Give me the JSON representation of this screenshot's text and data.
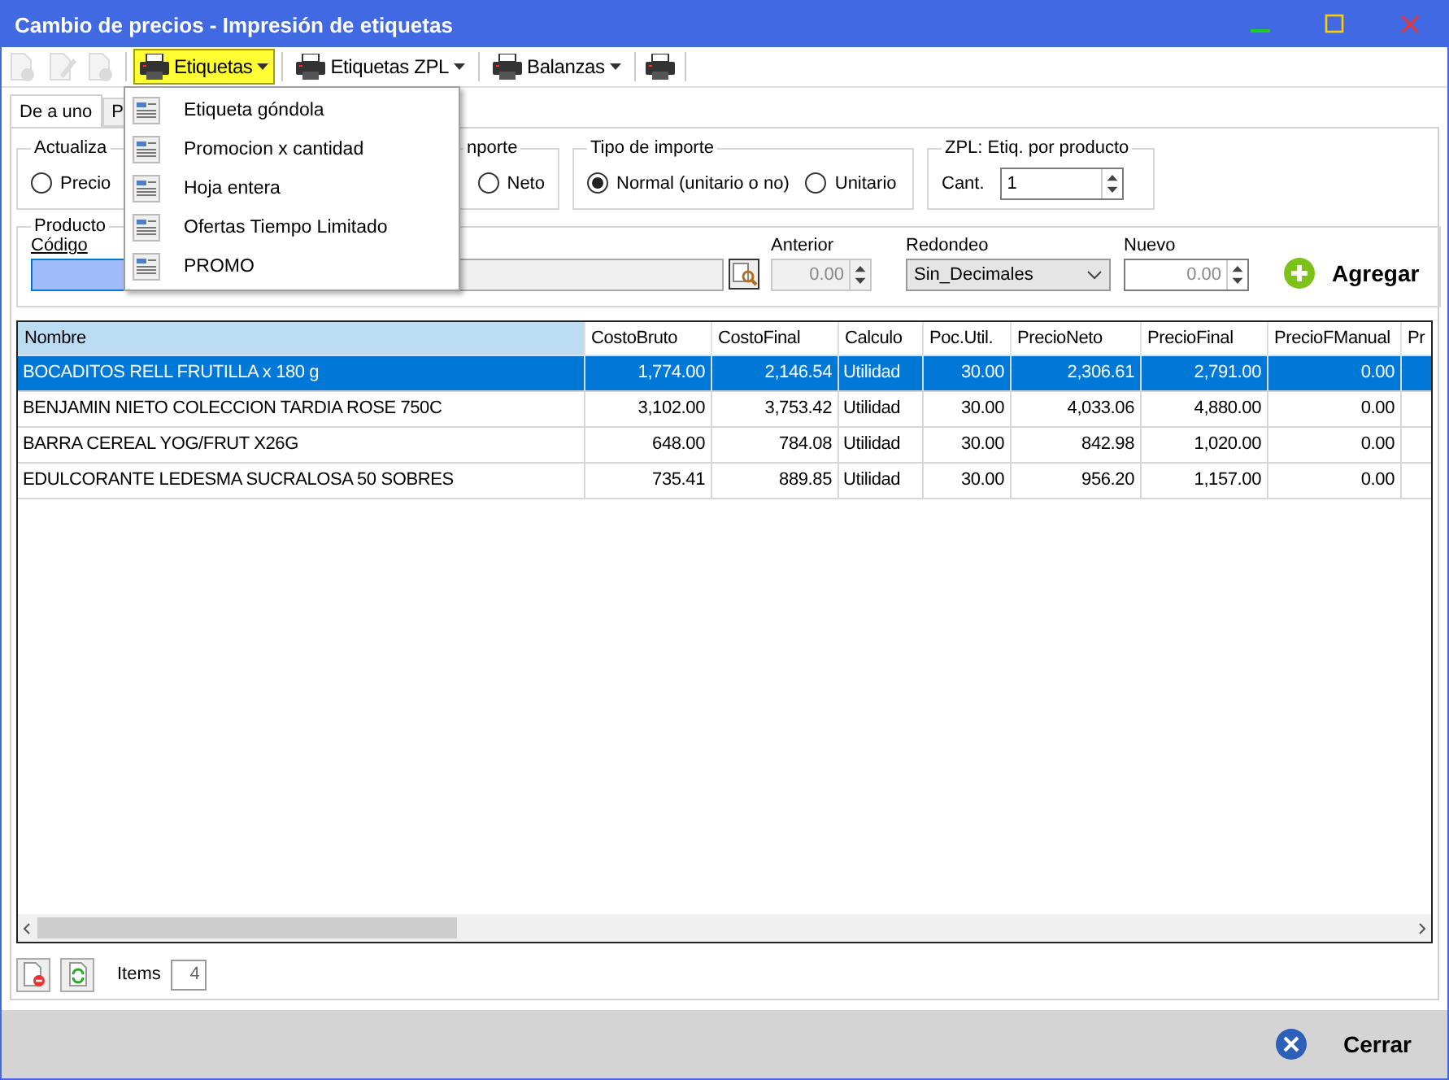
{
  "window": {
    "title": "Cambio de precios - Impresión de etiquetas"
  },
  "toolbar": {
    "icon_buttons": [
      {
        "kind": "new",
        "disabled": true
      },
      {
        "kind": "edit",
        "disabled": true
      },
      {
        "kind": "delete",
        "disabled": true
      }
    ],
    "menus": [
      {
        "label": "Etiquetas",
        "open": true
      },
      {
        "label": "Etiquetas ZPL",
        "open": false
      },
      {
        "label": "Balanzas",
        "open": false
      }
    ]
  },
  "menu": {
    "items": [
      "Etiqueta góndola",
      "Promocion x cantidad",
      "Hoja entera",
      "Ofertas Tiempo Limitado",
      "PROMO"
    ]
  },
  "tabs": [
    {
      "label": "De a uno",
      "selected": true
    },
    {
      "label": "P",
      "selected": false
    }
  ],
  "groups": [
    {
      "title": "Actualiza",
      "radios": [
        {
          "label": "Precio",
          "selected": false
        }
      ]
    },
    {
      "title": "nporte",
      "radios": [
        {
          "label": "Neto",
          "selected": false
        }
      ]
    },
    {
      "title": "Tipo de importe",
      "radios": [
        {
          "label": "Normal (unitario o no)",
          "selected": true
        },
        {
          "label": "Unitario",
          "selected": false
        }
      ]
    }
  ],
  "zpl": {
    "title": "ZPL: Etiq. por producto",
    "label": "Cant.",
    "value": "1"
  },
  "product": {
    "title": "Producto",
    "code_label": "Código",
    "anterior": {
      "label": "Anterior",
      "value": "0.00",
      "disabled": true
    },
    "redondeo": {
      "label": "Redondeo",
      "value": "Sin_Decimales"
    },
    "nuevo": {
      "label": "Nuevo",
      "value": "0.00",
      "disabled": false
    },
    "add_button": "Agregar"
  },
  "table": {
    "columns": [
      {
        "label": "Nombre",
        "selected": true
      },
      {
        "label": "CostoBruto",
        "selected": false
      },
      {
        "label": "CostoFinal",
        "selected": false
      },
      {
        "label": "Calculo",
        "selected": false
      },
      {
        "label": "Poc.Util.",
        "selected": false
      },
      {
        "label": "PrecioNeto",
        "selected": false
      },
      {
        "label": "PrecioFinal",
        "selected": false
      },
      {
        "label": "PrecioFManual",
        "selected": false
      },
      {
        "label": "Pr",
        "selected": false
      }
    ],
    "rows": [
      {
        "selected": true,
        "cells": [
          "BOCADITOS RELL FRUTILLA x 180 g",
          "1,774.00",
          "2,146.54",
          "Utilidad",
          "30.00",
          "2,306.61",
          "2,791.00",
          "0.00"
        ]
      },
      {
        "selected": false,
        "cells": [
          "BENJAMIN NIETO COLECCION TARDIA ROSE 750C",
          "3,102.00",
          "3,753.42",
          "Utilidad",
          "30.00",
          "4,033.06",
          "4,880.00",
          "0.00"
        ]
      },
      {
        "selected": false,
        "cells": [
          "BARRA CEREAL YOG/FRUT X26G",
          "648.00",
          "784.08",
          "Utilidad",
          "30.00",
          "842.98",
          "1,020.00",
          "0.00"
        ]
      },
      {
        "selected": false,
        "cells": [
          "EDULCORANTE LEDESMA SUCRALOSA 50 SOBRES",
          "735.41",
          "889.85",
          "Utilidad",
          "30.00",
          "956.20",
          "1,157.00",
          "0.00"
        ]
      }
    ]
  },
  "items": {
    "label": "Items",
    "value": "4"
  },
  "close_button": "Cerrar"
}
